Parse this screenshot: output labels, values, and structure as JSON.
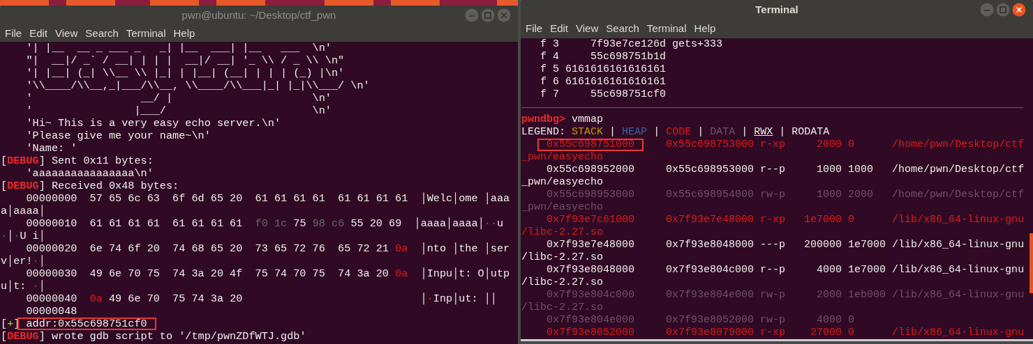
{
  "windows": [
    {
      "title": "pwn@ubuntu: ~/Desktop/ctf_pwn",
      "active": false,
      "menu": [
        "File",
        "Edit",
        "View",
        "Search",
        "Terminal",
        "Help"
      ],
      "lines": [
        {
          "kind": "text",
          "spans": [
            {
              "text": "    '| |__  __ _ ___ _   _| |__  ___| |__   ___  \\n'",
              "kind": "plain"
            }
          ]
        },
        {
          "kind": "text",
          "spans": [
            {
              "text": "    \"|  __|/ _` / __| | | |  __|/ __| '_ \\\\ / _ \\\\ \\n\"",
              "kind": "plain"
            }
          ]
        },
        {
          "kind": "text",
          "spans": [
            {
              "text": "    '| |__| (_| \\\\__ \\\\ |_| | |__| (__| | | | (_) |\\n'",
              "kind": "plain"
            }
          ]
        },
        {
          "kind": "text",
          "spans": [
            {
              "text": "    '\\\\____/\\\\__,_|___/\\\\__, \\\\____/\\\\___|_| |_|\\\\___/ \\n'",
              "kind": "plain"
            }
          ]
        },
        {
          "kind": "text",
          "spans": [
            {
              "text": "    '                 __/ |                      \\n'",
              "kind": "plain"
            }
          ]
        },
        {
          "kind": "text",
          "spans": [
            {
              "text": "    '                |___/                       \\n'",
              "kind": "plain"
            }
          ]
        },
        {
          "kind": "text",
          "spans": [
            {
              "text": "    'Hi~ This is a very easy echo server.\\n'",
              "kind": "plain"
            }
          ]
        },
        {
          "kind": "text",
          "spans": [
            {
              "text": "    'Please give me your name~\\n'",
              "kind": "plain"
            }
          ]
        },
        {
          "kind": "text",
          "spans": [
            {
              "text": "    'Name: '",
              "kind": "plain"
            }
          ]
        },
        {
          "kind": "text",
          "spans": [
            {
              "text": "[",
              "kind": "plain"
            },
            {
              "text": "DEBUG",
              "kind": "bold-red"
            },
            {
              "text": "] Sent 0x11 bytes:",
              "kind": "plain"
            }
          ]
        },
        {
          "kind": "text",
          "spans": [
            {
              "text": "    'aaaaaaaaaaaaaaaa\\n'",
              "kind": "plain"
            }
          ]
        },
        {
          "kind": "text",
          "spans": [
            {
              "text": "[",
              "kind": "plain"
            },
            {
              "text": "DEBUG",
              "kind": "bold-red"
            },
            {
              "text": "] Received 0x48 bytes:",
              "kind": "plain"
            }
          ]
        },
        {
          "kind": "text",
          "spans": [
            {
              "text": "    00000000  57 65 6c 63  6f 6d 65 20  61 61 61 61  61 61 61 61  │Welc│ome │aaa",
              "kind": "plain"
            }
          ]
        },
        {
          "kind": "text",
          "spans": [
            {
              "text": "a│aaaa│",
              "kind": "plain"
            }
          ]
        },
        {
          "kind": "text",
          "spans": [
            {
              "text": "    00000010  61 61 61 61  61 61 61 61  ",
              "kind": "plain"
            },
            {
              "text": "f0 1c",
              "kind": "dim-gray"
            },
            {
              "text": " 75 ",
              "kind": "plain"
            },
            {
              "text": "98",
              "kind": "dim-gray"
            },
            {
              "text": " c6",
              "kind": "dim-gray"
            },
            {
              "text": " 55 20 69  │aaaa│aaaa│",
              "kind": "plain"
            },
            {
              "text": "··",
              "kind": "dim-gray"
            },
            {
              "text": "u",
              "kind": "plain"
            }
          ]
        },
        {
          "kind": "text",
          "spans": [
            {
              "text": "·",
              "kind": "dim-gray"
            },
            {
              "text": "│",
              "kind": "plain"
            },
            {
              "text": "·",
              "kind": "dim-gray"
            },
            {
              "text": "U i│",
              "kind": "plain"
            }
          ]
        },
        {
          "kind": "text",
          "spans": [
            {
              "text": "    00000020  6e 74 6f 20  74 68 65 20  73 65 72 76  65 72 21 ",
              "kind": "plain"
            },
            {
              "text": "0a",
              "kind": "red"
            },
            {
              "text": "  │nto │the │ser",
              "kind": "plain"
            }
          ]
        },
        {
          "kind": "text",
          "spans": [
            {
              "text": "v│er!",
              "kind": "plain"
            },
            {
              "text": "·",
              "kind": "red"
            },
            {
              "text": "│",
              "kind": "plain"
            }
          ]
        },
        {
          "kind": "text",
          "spans": [
            {
              "text": "    00000030  49 6e 70 75  74 3a 20 4f  75 74 70 75  74 3a 20 ",
              "kind": "plain"
            },
            {
              "text": "0a",
              "kind": "red"
            },
            {
              "text": "  │Inpu│t: O│utp",
              "kind": "plain"
            }
          ]
        },
        {
          "kind": "text",
          "spans": [
            {
              "text": "u│t: ",
              "kind": "plain"
            },
            {
              "text": "·",
              "kind": "red"
            },
            {
              "text": "│",
              "kind": "plain"
            }
          ]
        },
        {
          "kind": "text",
          "spans": [
            {
              "text": "    00000040  ",
              "kind": "plain"
            },
            {
              "text": "0a",
              "kind": "red"
            },
            {
              "text": " 49 6e 70  75 74 3a 20                            │",
              "kind": "plain"
            },
            {
              "text": "·",
              "kind": "red"
            },
            {
              "text": "Inp│ut: ││",
              "kind": "plain"
            }
          ]
        },
        {
          "kind": "text",
          "spans": [
            {
              "text": "    00000048",
              "kind": "plain"
            }
          ]
        },
        {
          "kind": "text",
          "spans": [
            {
              "text": "[",
              "kind": "plain"
            },
            {
              "text": "+",
              "kind": "green"
            },
            {
              "text": "] ",
              "kind": "plain"
            },
            {
              "text": "addr:0x55c698751cf0",
              "kind": "plain",
              "highlighted": true
            }
          ]
        },
        {
          "kind": "text",
          "spans": [
            {
              "text": "[",
              "kind": "plain"
            },
            {
              "text": "DEBUG",
              "kind": "bold-red"
            },
            {
              "text": "] wrote gdb script to '/tmp/pwnZDfWTJ.gdb'",
              "kind": "plain"
            }
          ]
        }
      ]
    },
    {
      "title": "Terminal",
      "active": true,
      "menu": [
        "File",
        "Edit",
        "View",
        "Search",
        "Terminal",
        "Help"
      ],
      "lines": [
        {
          "kind": "text",
          "spans": [
            {
              "text": "   f 3     7f93e7ce126d gets+333",
              "kind": "plain"
            }
          ]
        },
        {
          "kind": "text",
          "spans": [
            {
              "text": "   f 4     55c698751b1d",
              "kind": "plain"
            }
          ]
        },
        {
          "kind": "text",
          "spans": [
            {
              "text": "   f 5 6161616161616161",
              "kind": "plain"
            }
          ]
        },
        {
          "kind": "text",
          "spans": [
            {
              "text": "   f 6 6161616161616161",
              "kind": "plain"
            }
          ]
        },
        {
          "kind": "text",
          "spans": [
            {
              "text": "   f 7     55c698751cf0",
              "kind": "plain"
            }
          ]
        },
        {
          "kind": "rule"
        },
        {
          "kind": "text",
          "spans": [
            {
              "text": "pwndbg>",
              "kind": "bold-red"
            },
            {
              "text": " vmmap",
              "kind": "plain"
            }
          ]
        },
        {
          "kind": "text",
          "spans": [
            {
              "text": "LEGEND: ",
              "kind": "plain"
            },
            {
              "text": "STACK",
              "kind": "yellow"
            },
            {
              "text": " | ",
              "kind": "plain"
            },
            {
              "text": "HEAP",
              "kind": "blue"
            },
            {
              "text": " | ",
              "kind": "plain"
            },
            {
              "text": "CODE",
              "kind": "red"
            },
            {
              "text": " | ",
              "kind": "plain"
            },
            {
              "text": "DATA",
              "kind": "dim-purple"
            },
            {
              "text": " | ",
              "kind": "plain"
            },
            {
              "text": "RWX",
              "kind": "underline"
            },
            {
              "text": " | RODATA",
              "kind": "plain"
            }
          ]
        },
        {
          "kind": "text",
          "spans": [
            {
              "text": "    0x55c698751000",
              "kind": "red",
              "highlighted": true
            },
            {
              "text": "     0x55c698753000 r-xp     2000 0      /home/pwn/Desktop/ctf",
              "kind": "red"
            }
          ]
        },
        {
          "kind": "text",
          "spans": [
            {
              "text": "_pwn/easyecho",
              "kind": "red"
            }
          ]
        },
        {
          "kind": "text",
          "spans": [
            {
              "text": "    0x55c698952000     0x55c698953000 r--p     1000 1000   /home/pwn/Desktop/ctf",
              "kind": "plain"
            }
          ]
        },
        {
          "kind": "text",
          "spans": [
            {
              "text": "_pwn/easyecho",
              "kind": "plain"
            }
          ]
        },
        {
          "kind": "text",
          "spans": [
            {
              "text": "    0x55c698953000     0x55c698954000 rw-p     1000 2000   /home/pwn/Desktop/ctf",
              "kind": "dim-purple"
            }
          ]
        },
        {
          "kind": "text",
          "spans": [
            {
              "text": "_pwn/easyecho",
              "kind": "dim-purple"
            }
          ]
        },
        {
          "kind": "text",
          "spans": [
            {
              "text": "    0x7f93e7c61000     0x7f93e7e48000 r-xp   1e7000 0      /lib/x86_64-linux-gnu",
              "kind": "red"
            }
          ]
        },
        {
          "kind": "text",
          "spans": [
            {
              "text": "/libc-2.27.so",
              "kind": "red"
            }
          ]
        },
        {
          "kind": "text",
          "spans": [
            {
              "text": "    0x7f93e7e48000     0x7f93e8048000 ---p   200000 1e7000 /lib/x86_64-linux-gnu",
              "kind": "plain"
            }
          ]
        },
        {
          "kind": "text",
          "spans": [
            {
              "text": "/libc-2.27.so",
              "kind": "plain"
            }
          ]
        },
        {
          "kind": "text",
          "spans": [
            {
              "text": "    0x7f93e8048000     0x7f93e804c000 r--p     4000 1e7000 /lib/x86_64-linux-gnu",
              "kind": "plain"
            }
          ]
        },
        {
          "kind": "text",
          "spans": [
            {
              "text": "/libc-2.27.so",
              "kind": "plain"
            }
          ]
        },
        {
          "kind": "text",
          "spans": [
            {
              "text": "    0x7f93e804c000     0x7f93e804e000 rw-p     2000 1eb000 /lib/x86_64-linux-gnu",
              "kind": "dim-purple"
            }
          ]
        },
        {
          "kind": "text",
          "spans": [
            {
              "text": "/libc-2.27.so",
              "kind": "dim-purple"
            }
          ]
        },
        {
          "kind": "text",
          "spans": [
            {
              "text": "    0x7f93e804e000     0x7f93e8052000 rw-p     4000 0",
              "kind": "dim-purple"
            }
          ]
        },
        {
          "kind": "text",
          "spans": [
            {
              "text": "    0x7f93e8052000     0x7f93e8079000 r-xp    27000 0      /lib/x86_64-linux-gnu",
              "kind": "red"
            }
          ]
        }
      ]
    }
  ]
}
